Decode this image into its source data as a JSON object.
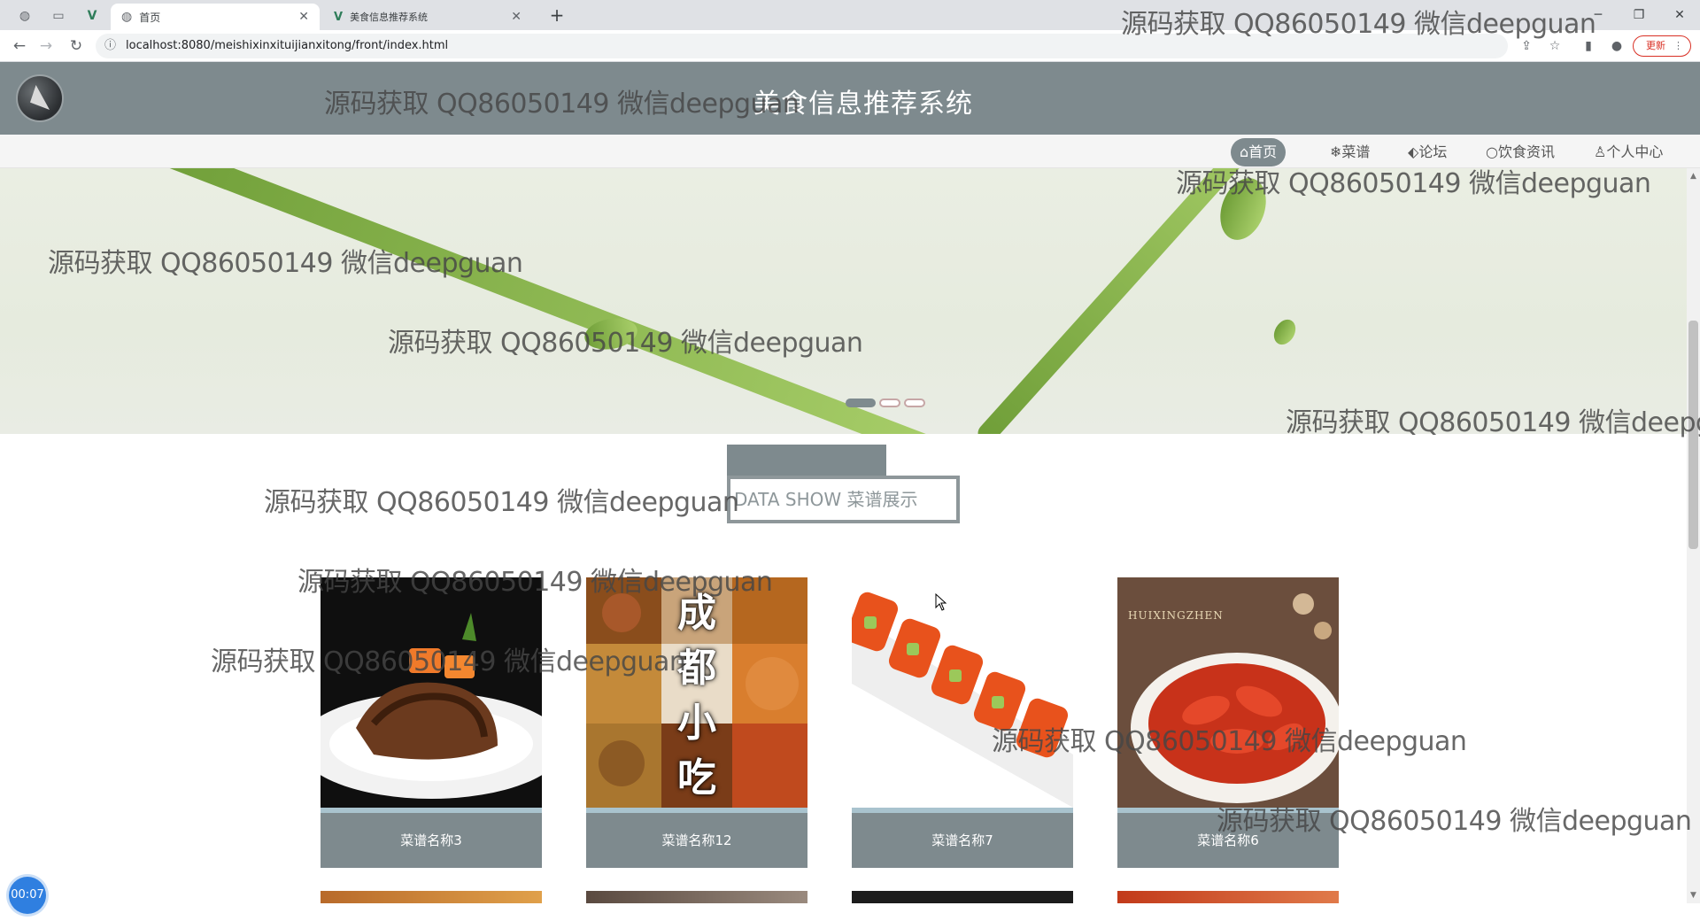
{
  "browser": {
    "tabs": [
      {
        "title": "首页",
        "active": true
      },
      {
        "title": "美食信息推荐系统",
        "active": false
      }
    ],
    "url": "localhost:8080/meishixinxituijianxitong/front/index.html",
    "update_label": "更新"
  },
  "site": {
    "title": "美食信息推荐系统",
    "brand_color": "#7e8a8e"
  },
  "nav": [
    {
      "icon": "home-icon",
      "glyph": "⌂",
      "label": "首页",
      "active": true
    },
    {
      "icon": "snowflake-icon",
      "glyph": "❄",
      "label": "菜谱",
      "active": false
    },
    {
      "icon": "tag-icon",
      "glyph": "🏷",
      "label": "论坛",
      "active": false
    },
    {
      "icon": "circle-icon",
      "glyph": "○",
      "label": "饮食资讯",
      "active": false
    },
    {
      "icon": "user-icon",
      "glyph": "♙",
      "label": "个人中心",
      "active": false
    }
  ],
  "section": {
    "title": "DATA SHOW 菜谱展示"
  },
  "cards": [
    {
      "label": "菜谱名称3"
    },
    {
      "label": "菜谱名称12",
      "overlay_text": [
        "成",
        "都",
        "小",
        "吃"
      ]
    },
    {
      "label": "菜谱名称7"
    },
    {
      "label": "菜谱名称6",
      "image_text": "HUIXINGZHEN"
    }
  ],
  "recorder": {
    "time": "00:07"
  },
  "watermark": "源码获取 QQ86050149 微信deepguan",
  "watermark_partial": "源码获取 QQ86050149 微信deepg"
}
